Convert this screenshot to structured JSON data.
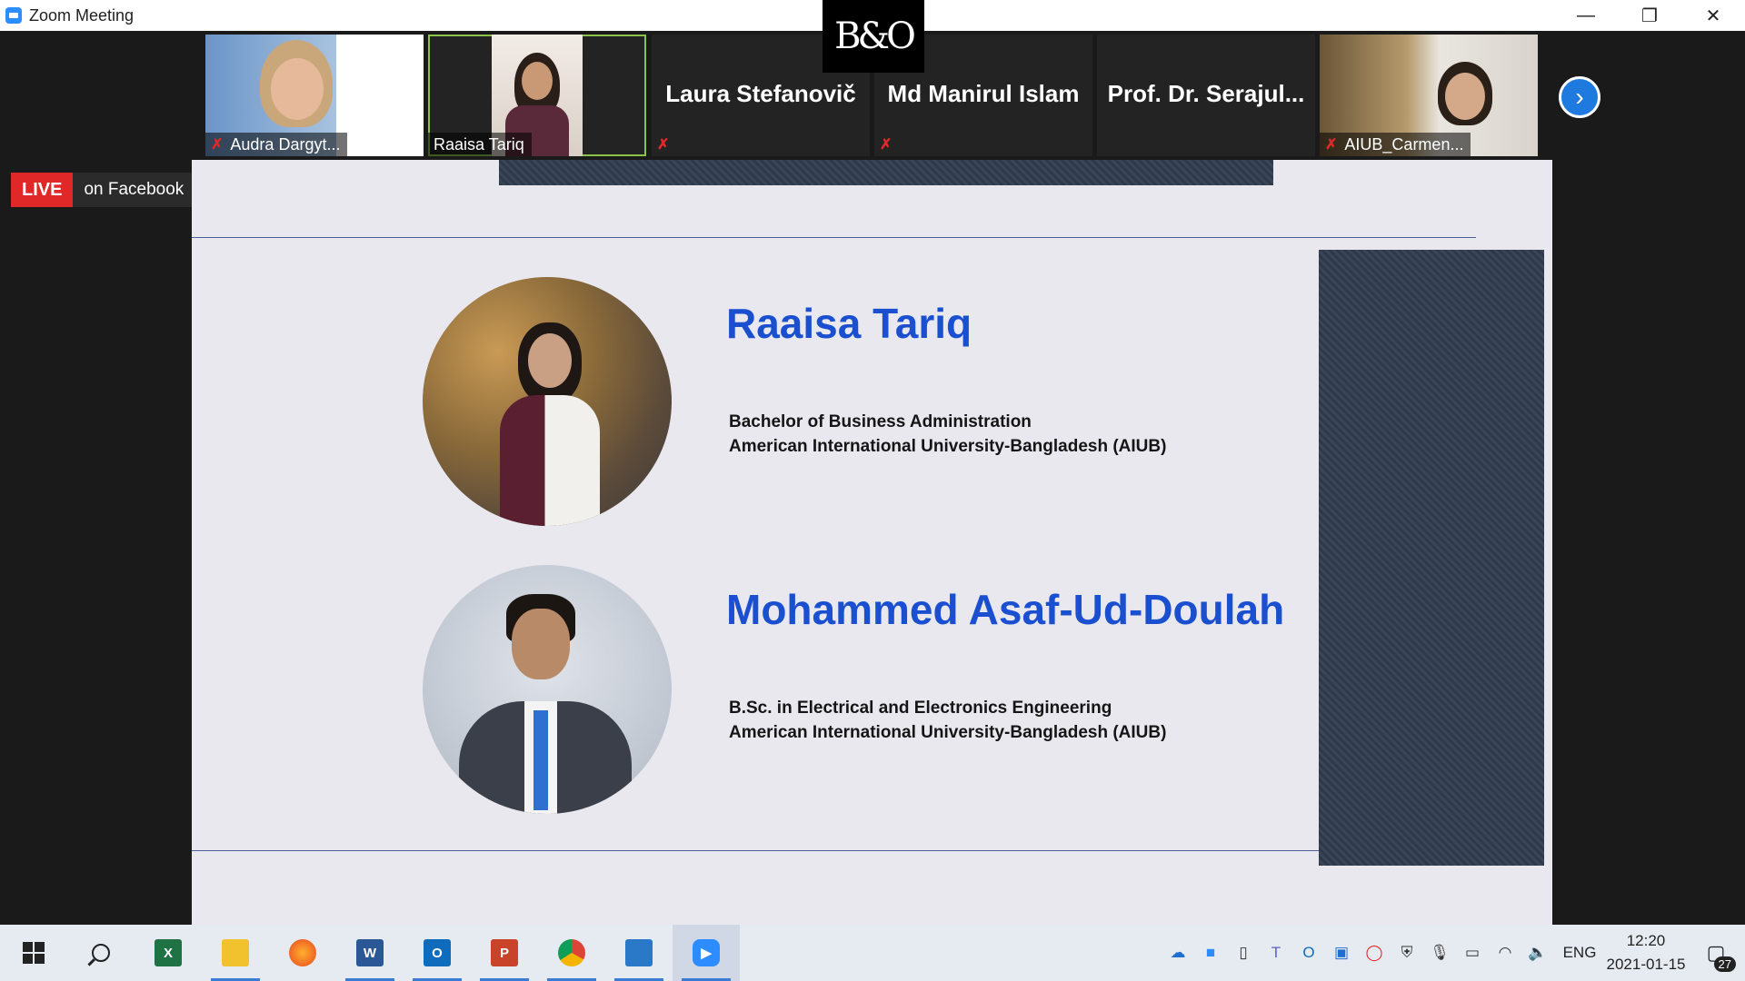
{
  "window": {
    "title": "Zoom Meeting",
    "minimize": "—",
    "restore": "❐",
    "close": "✕",
    "brand_logo": "B&O"
  },
  "participants": [
    {
      "name": "Audra Dargyt...",
      "muted": true,
      "video": true
    },
    {
      "name": "Raaisa Tariq",
      "muted": false,
      "video": true,
      "active_speaker": true
    },
    {
      "name": "Laura Stefanovič",
      "muted": true,
      "video": false
    },
    {
      "name": "Md Manirul Islam",
      "muted": true,
      "video": false
    },
    {
      "name": "Prof. Dr. Serajul...",
      "muted": false,
      "video": false
    },
    {
      "name": "AIUB_Carmen...",
      "muted": true,
      "video": true
    }
  ],
  "next_page_icon": "chevron-right-icon",
  "live": {
    "tag": "LIVE",
    "platform": "on Facebook"
  },
  "slide": {
    "speakers": [
      {
        "name": "Raaisa Tariq",
        "degree": "Bachelor of Business Administration",
        "institution": "American International University-Bangladesh (AIUB)"
      },
      {
        "name": "Mohammed Asaf-Ud-Doulah",
        "degree": "B.Sc. in Electrical and Electronics Engineering",
        "institution": "American International University-Bangladesh (AIUB)"
      }
    ],
    "accent_color": "#1a4fd0"
  },
  "taskbar": {
    "apps": [
      "start-icon",
      "search-icon",
      "excel-icon",
      "file-explorer-icon",
      "firefox-icon",
      "word-icon",
      "outlook-icon",
      "powerpoint-icon",
      "chrome-icon",
      "photos-icon",
      "zoom-icon"
    ],
    "language": "ENG",
    "time": "12:20",
    "date": "2021-01-15",
    "notifications": "27"
  }
}
